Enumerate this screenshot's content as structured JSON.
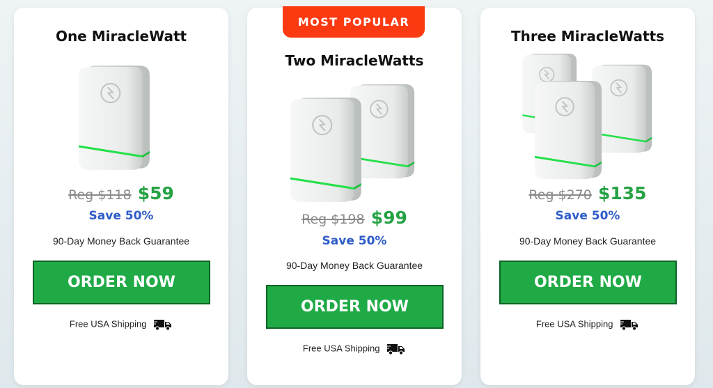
{
  "accent": "#1faa46",
  "badge_color": "#fc3a12",
  "sale_color": "#25a244",
  "save_color": "#2e5cc8",
  "cards": [
    {
      "title": "One MiracleWatt",
      "reg_price": "Reg $118",
      "sale_price": "$59",
      "save": "Save 50%",
      "guarantee": "90-Day Money Back Guarantee",
      "button": "ORDER NOW",
      "shipping": "Free USA Shipping",
      "shipping_icon": "truck-icon",
      "device_count": 1
    },
    {
      "badge": "MOST POPULAR",
      "title": "Two MiracleWatts",
      "reg_price": "Reg $198",
      "sale_price": "$99",
      "save": "Save 50%",
      "guarantee": "90-Day Money Back Guarantee",
      "button": "ORDER NOW",
      "shipping": "Free USA Shipping",
      "shipping_icon": "truck-icon",
      "device_count": 2
    },
    {
      "title": "Three MiracleWatts",
      "reg_price": "Reg $270",
      "sale_price": "$135",
      "save": "Save 50%",
      "guarantee": "90-Day Money Back Guarantee",
      "button": "ORDER NOW",
      "shipping": "Free USA Shipping",
      "shipping_icon": "truck-icon",
      "device_count": 3
    }
  ]
}
